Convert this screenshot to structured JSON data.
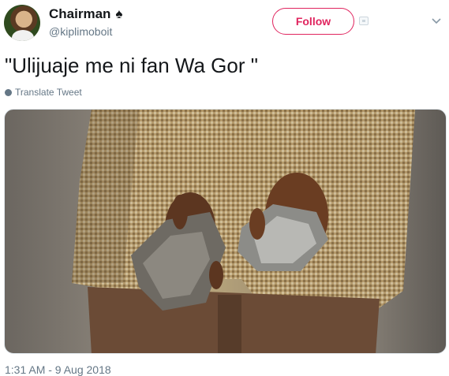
{
  "author": {
    "display_name": "Chairman",
    "badge_icon": "spade-icon",
    "handle": "@kiplimoboit"
  },
  "actions": {
    "follow_label": "Follow",
    "follow_color": "#e0245e"
  },
  "tweet": {
    "text": "\"Ulijuaje me ni fan Wa Gor \"",
    "translate_label": "Translate Tweet",
    "timestamp": "1:31 AM - 9 Aug 2018"
  },
  "colors": {
    "text_primary": "#14171a",
    "text_secondary": "#657786"
  }
}
